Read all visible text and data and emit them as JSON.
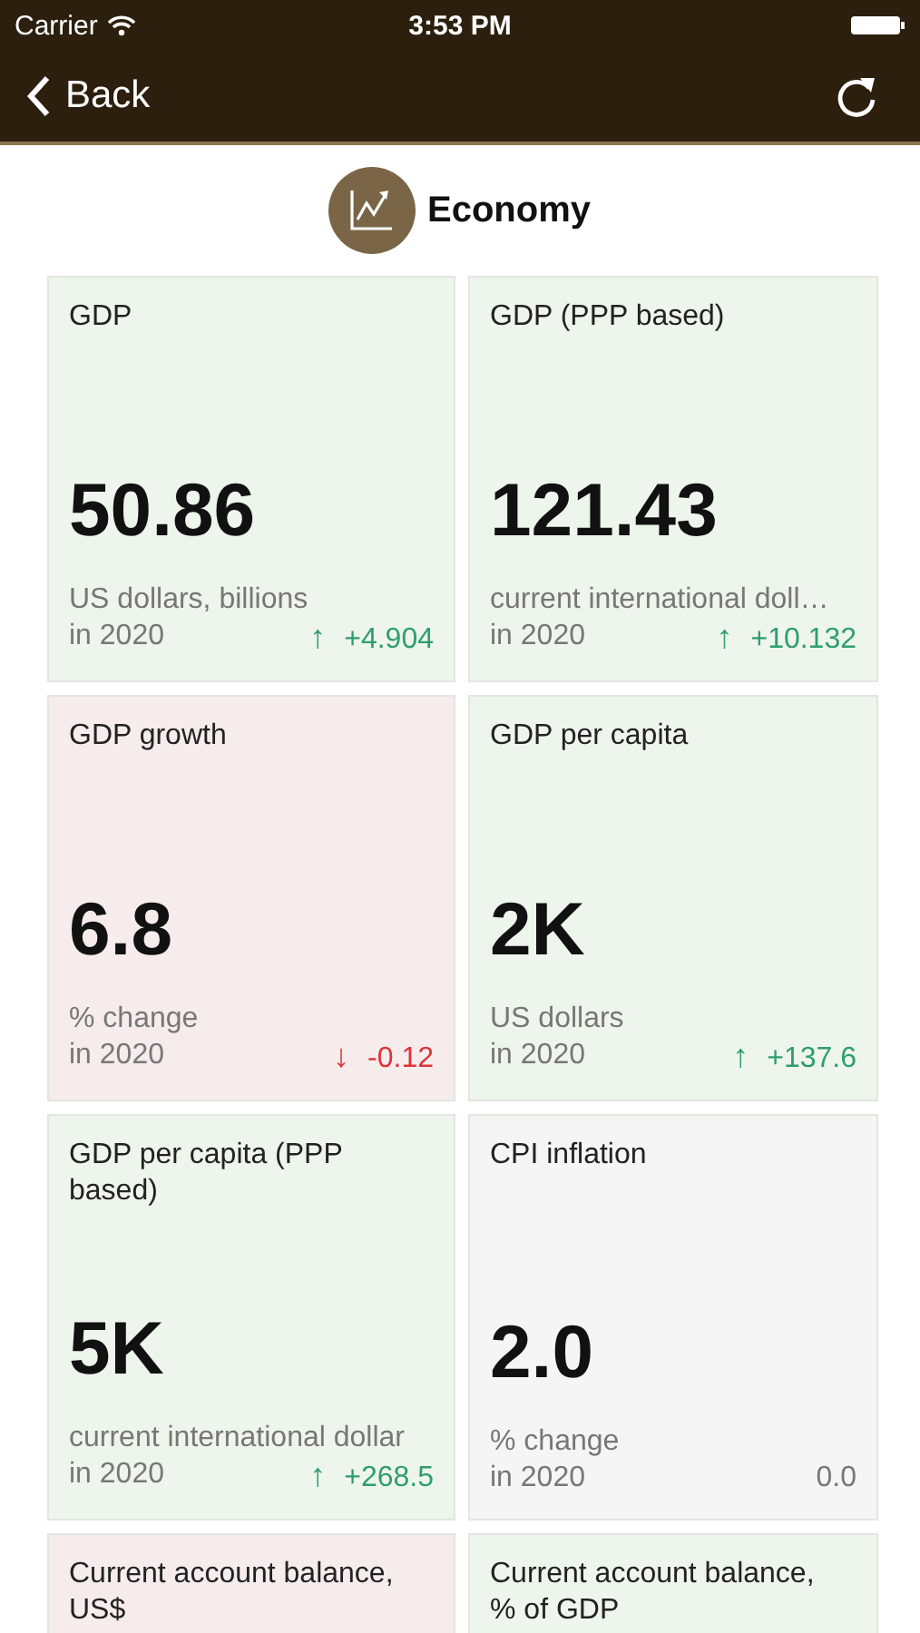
{
  "status_bar": {
    "carrier": "Carrier",
    "time": "3:53 PM"
  },
  "nav": {
    "back": "Back"
  },
  "section": {
    "title": "Economy"
  },
  "cards": [
    {
      "title": "GDP",
      "value": "50.86",
      "unit": "US dollars, billions",
      "year": "in 2020",
      "color": "#eef5ec",
      "change": {
        "arrow": "↑",
        "text": "+4.904",
        "color": "#2e9e6e"
      }
    },
    {
      "title": "GDP (PPP based)",
      "value": "121.43",
      "unit": "current international doll…",
      "year": "in 2020",
      "color": "#eef5ec",
      "change": {
        "arrow": "↑",
        "text": "+10.132",
        "color": "#2e9e6e"
      }
    },
    {
      "title": "GDP growth",
      "value": "6.8",
      "unit": "% change",
      "year": "in 2020",
      "color": "#f6ecec",
      "change": {
        "arrow": "↓",
        "text": "-0.12",
        "color": "#e0333a"
      }
    },
    {
      "title": "GDP per capita",
      "value": "2K",
      "unit": "US dollars",
      "year": "in 2020",
      "color": "#eef5ec",
      "change": {
        "arrow": "↑",
        "text": "+137.6",
        "color": "#2e9e6e"
      }
    },
    {
      "title": "GDP per capita (PPP based)",
      "value": "5K",
      "unit": "current international dollar",
      "year": "in 2020",
      "color": "#eef5ec",
      "change": {
        "arrow": "↑",
        "text": "+268.5",
        "color": "#2e9e6e"
      }
    },
    {
      "title": "CPI inflation",
      "value": "2.0",
      "unit": "% change",
      "year": "in 2020",
      "color": "#f5f5f5",
      "change": {
        "text": "0.0",
        "color": "#777777"
      }
    },
    {
      "title": "Current account balance, US$",
      "color": "#f6ecec"
    },
    {
      "title": "Current account balance, % of GDP",
      "color": "#eef5ec"
    }
  ]
}
